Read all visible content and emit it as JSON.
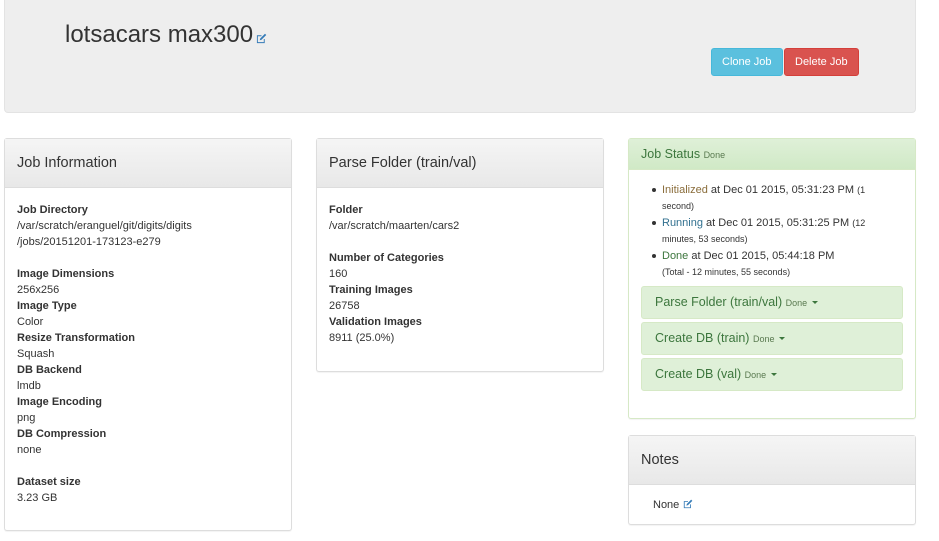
{
  "header": {
    "title": "lotsacars max300",
    "clone_label": "Clone Job",
    "delete_label": "Delete Job"
  },
  "job_info": {
    "heading": "Job Information",
    "directory_label": "Job Directory",
    "directory_line1": "/var/scratch/eranguel/git/digits/digits",
    "directory_line2": "/jobs/20151201-173123-e279",
    "dimensions_label": "Image Dimensions",
    "dimensions_value": "256x256",
    "type_label": "Image Type",
    "type_value": "Color",
    "resize_label": "Resize Transformation",
    "resize_value": "Squash",
    "backend_label": "DB Backend",
    "backend_value": "lmdb",
    "encoding_label": "Image Encoding",
    "encoding_value": "png",
    "compression_label": "DB Compression",
    "compression_value": "none",
    "dataset_size_label": "Dataset size",
    "dataset_size_value": "3.23 GB"
  },
  "parse_folder": {
    "heading": "Parse Folder (train/val)",
    "folder_label": "Folder",
    "folder_value": "/var/scratch/maarten/cars2",
    "categories_label": "Number of Categories",
    "categories_value": "160",
    "training_label": "Training Images",
    "training_value": "26758",
    "validation_label": "Validation Images",
    "validation_value": "8911 (25.0%)"
  },
  "job_status": {
    "heading": "Job Status",
    "heading_status": "Done",
    "events": [
      {
        "state": "Initialized",
        "text": " at Dec 01 2015, 05:31:23 PM",
        "duration": "(1 second)"
      },
      {
        "state": "Running",
        "text": " at Dec 01 2015, 05:31:25 PM",
        "duration": "(12 minutes, 53 seconds)"
      },
      {
        "state": "Done",
        "text": " at Dec 01 2015, 05:44:18 PM",
        "duration": "(Total - 12 minutes, 55 seconds)"
      }
    ],
    "tasks": [
      {
        "label": "Parse Folder (train/val)",
        "status": "Done"
      },
      {
        "label": "Create DB (train)",
        "status": "Done"
      },
      {
        "label": "Create DB (val)",
        "status": "Done"
      }
    ]
  },
  "notes": {
    "heading": "Notes",
    "value": "None"
  },
  "colors": {
    "clone_button": "#5bc0de",
    "delete_button": "#d9534f",
    "status_panel": "#dff0d8",
    "edit_icon": "#337ab7"
  },
  "icons": [
    "edit-icon",
    "caret-down-icon"
  ]
}
